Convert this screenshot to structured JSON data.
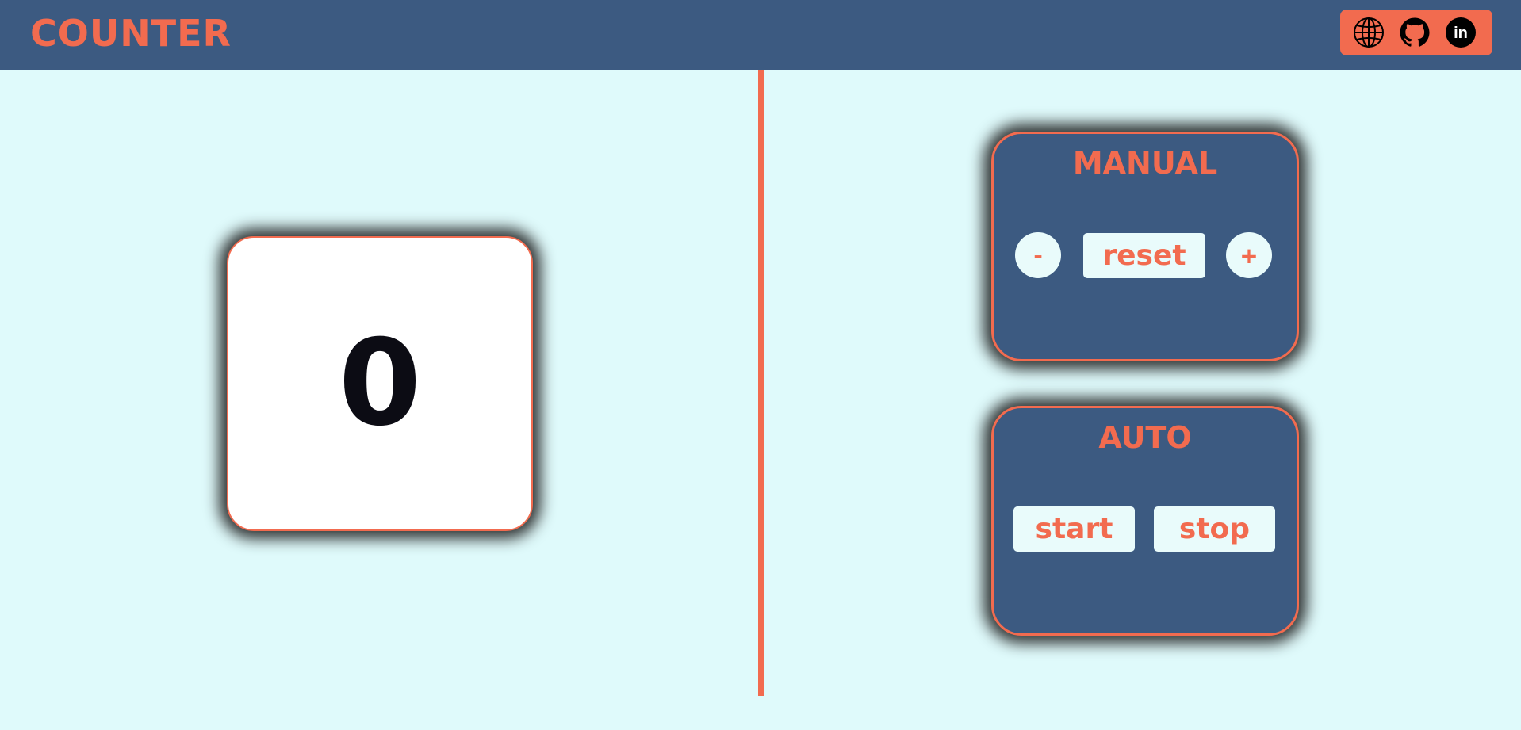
{
  "header": {
    "title": "COUNTER",
    "social": [
      {
        "name": "globe-icon"
      },
      {
        "name": "github-icon"
      },
      {
        "name": "linkedin-icon",
        "text": "in"
      }
    ]
  },
  "counter": {
    "value": "0"
  },
  "manual": {
    "title": "MANUAL",
    "decrement_label": "-",
    "reset_label": "reset",
    "increment_label": "+"
  },
  "auto": {
    "title": "AUTO",
    "start_label": "start",
    "stop_label": "stop"
  },
  "colors": {
    "header_bg": "#3c5a81",
    "accent": "#f26b4f",
    "page_bg": "#dffafb",
    "button_bg": "#e9fbfb",
    "counter_text": "#0c0c14"
  }
}
